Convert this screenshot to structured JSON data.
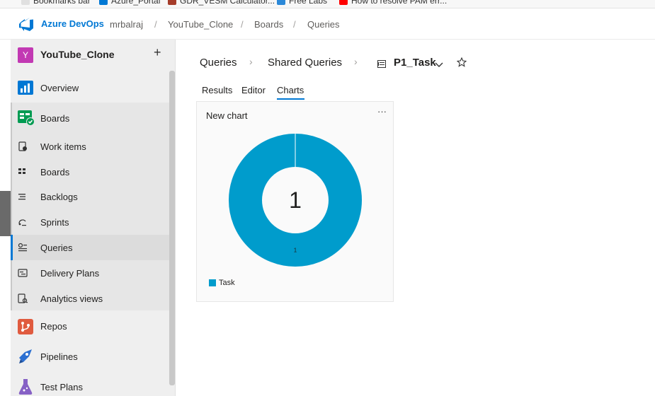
{
  "bookmarks": [
    {
      "label": "Bookmarks bar",
      "color": "#e0e0e0"
    },
    {
      "label": "Azure_Portal",
      "color": "#0078d4"
    },
    {
      "label": "GDR_VESM Calculator...",
      "color": "#a53c2a"
    },
    {
      "label": "Free Labs",
      "color": "#2b88d8"
    },
    {
      "label": "How to resolve PAM err...",
      "color": "#ff0000"
    }
  ],
  "header": {
    "brand": "Azure DevOps",
    "breadcrumbs": [
      "mrbalraj",
      "YouTube_Clone",
      "Boards",
      "Queries"
    ],
    "separator": "/"
  },
  "sidebar": {
    "project_initial": "Y",
    "project_name": "YouTube_Clone",
    "add_label": "+",
    "items": [
      {
        "label": "Overview",
        "icon": "overview-icon",
        "color": "#0078d4"
      },
      {
        "label": "Boards",
        "icon": "boards-hub-icon",
        "color": "#009b52"
      },
      {
        "label": "Work items",
        "icon": "work-items-icon"
      },
      {
        "label": "Boards",
        "icon": "boards-icon"
      },
      {
        "label": "Backlogs",
        "icon": "backlogs-icon"
      },
      {
        "label": "Sprints",
        "icon": "sprints-icon"
      },
      {
        "label": "Queries",
        "icon": "queries-icon"
      },
      {
        "label": "Delivery Plans",
        "icon": "delivery-plans-icon"
      },
      {
        "label": "Analytics views",
        "icon": "analytics-views-icon"
      },
      {
        "label": "Repos",
        "icon": "repos-icon",
        "color": "#e05b3f"
      },
      {
        "label": "Pipelines",
        "icon": "pipelines-icon",
        "color": "#2b6fd1"
      },
      {
        "label": "Test Plans",
        "icon": "test-plans-icon",
        "color": "#8661c5"
      }
    ]
  },
  "page": {
    "breadcrumb_root": "Queries",
    "breadcrumb_folder": "Shared Queries",
    "query_name": "P1_Task"
  },
  "tabs": [
    {
      "label": "Results",
      "active": false
    },
    {
      "label": "Editor",
      "active": false
    },
    {
      "label": "Charts",
      "active": true
    }
  ],
  "chart_card": {
    "title": "New chart",
    "more_label": "···"
  },
  "chart_data": {
    "type": "pie",
    "variant": "donut",
    "center_label": "1",
    "slices": [
      {
        "name": "Task",
        "value": 1,
        "label": "1",
        "color": "#009ccc"
      }
    ],
    "legend": "bottom-left"
  },
  "colors": {
    "accent": "#0078d4",
    "slice": "#009ccc",
    "project_badge": "#c239b3"
  }
}
